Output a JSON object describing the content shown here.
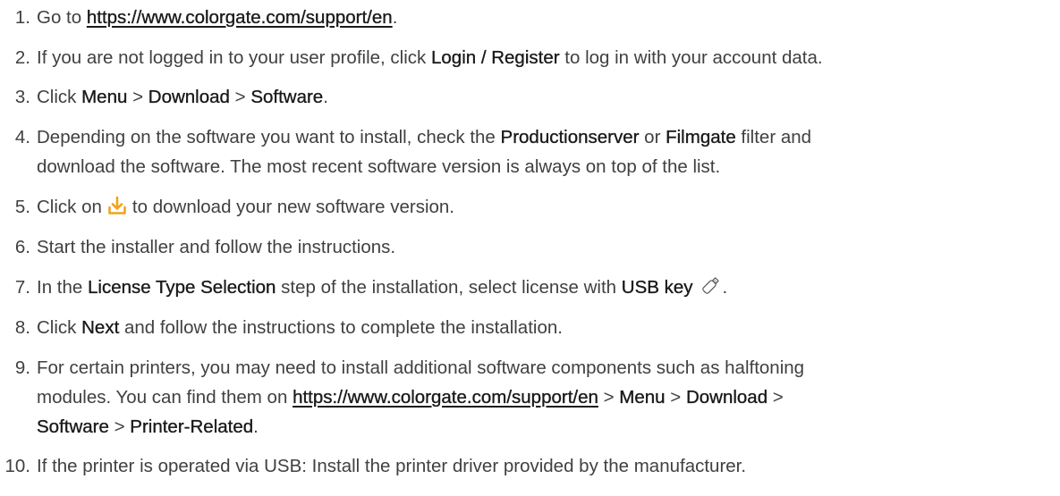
{
  "steps": [
    {
      "num": "1.",
      "parts": {
        "a": "Go to ",
        "link": "https://www.colorgate.com/support/en",
        "b": "."
      }
    },
    {
      "num": "2.",
      "parts": {
        "a": "If you are not logged in to your user profile, click ",
        "b1": "Login / Register",
        "c": " to log in with your account data."
      }
    },
    {
      "num": "3.",
      "parts": {
        "a": "Click ",
        "b1": "Menu",
        "sep1": " > ",
        "b2": "Download",
        "sep2": " > ",
        "b3": "Software",
        "end": "."
      }
    },
    {
      "num": "4.",
      "parts": {
        "a": "Depending on the software you want to install, check the ",
        "b1": "Productionserver",
        "or": " or ",
        "b2": "Filmgate",
        "c": " filter and",
        "line2": "download the software. The most recent software version is always on top of the list."
      }
    },
    {
      "num": "5.",
      "parts": {
        "a": "Click on",
        "icon": "download-icon",
        "b": "to download your new software version."
      }
    },
    {
      "num": "6.",
      "parts": {
        "a": "Start the installer and follow the instructions."
      }
    },
    {
      "num": "7.",
      "parts": {
        "a": "In the ",
        "b1": "License Type Selection",
        "c": " step of the installation, select license with ",
        "b2": "USB key",
        "icon": "usb-key-icon",
        "end": "."
      }
    },
    {
      "num": "8.",
      "parts": {
        "a": "Click ",
        "b1": "Next",
        "c": " and follow the instructions to complete the installation."
      }
    },
    {
      "num": "9.",
      "parts": {
        "a": "For certain printers, you may need to install additional software components such as halftoning",
        "line2a": "modules. You can find them on ",
        "link": "https://www.colorgate.com/support/en",
        "sep1": " > ",
        "b1": "Menu",
        "sep2": " > ",
        "b2": "Download",
        "sep3": " >",
        "b3": "Software",
        "sep4": " > ",
        "b4": "Printer-Related",
        "end": "."
      }
    },
    {
      "num": "10.",
      "parts": {
        "a": "If the printer is operated via USB: Install the printer driver provided by the manufacturer."
      }
    }
  ],
  "colors": {
    "text": "#404040",
    "emphasis": "#1a1a1a",
    "icon_accent": "#f2a31b"
  }
}
